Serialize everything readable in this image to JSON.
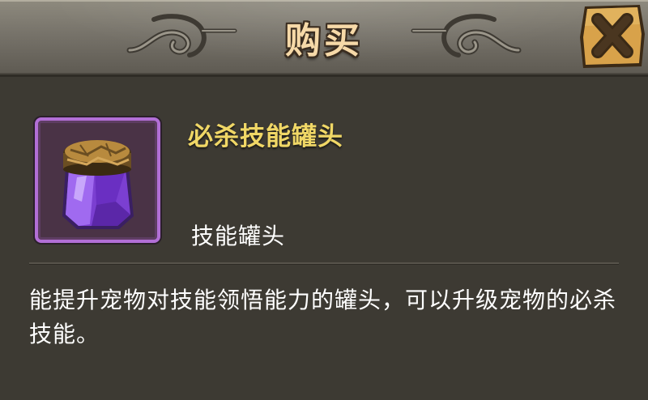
{
  "dialog": {
    "title": "购买",
    "close_icon": "close-x-icon"
  },
  "item": {
    "name": "必杀技能罐头",
    "type": "技能罐头",
    "icon": "purple-crystal-jar-icon",
    "frame_color": "#b26fd6",
    "name_color": "#f0d766",
    "description": "能提升宠物对技能领悟能力的罐头，可以升级宠物的必杀技能。"
  }
}
